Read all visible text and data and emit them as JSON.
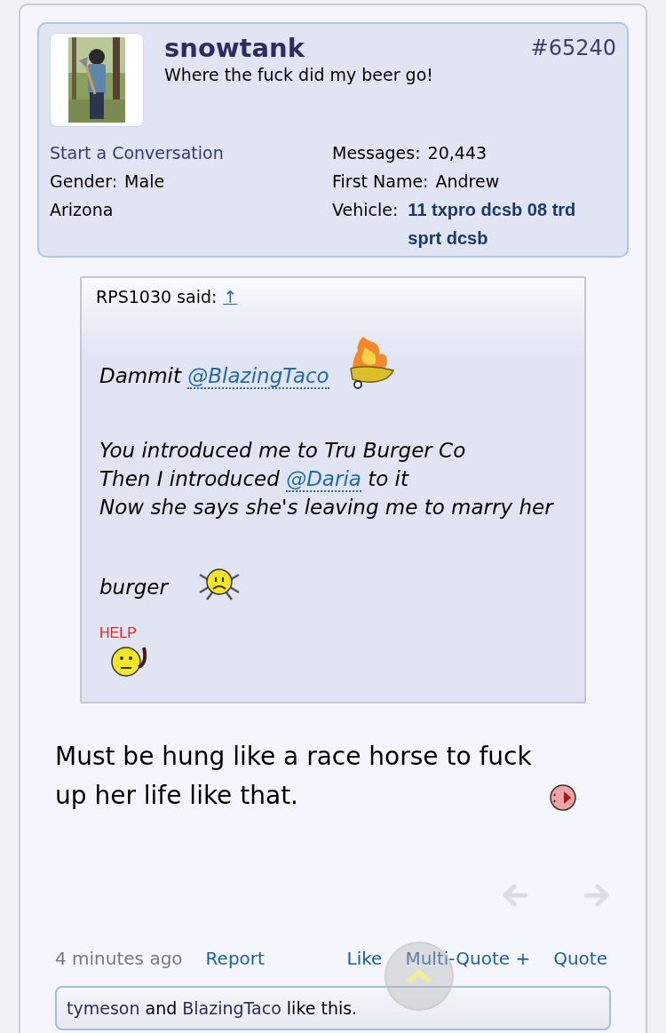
{
  "post": {
    "number": "#65240",
    "user": {
      "name": "snowtank",
      "title": "Where the fuck did my beer go!"
    },
    "left_info": [
      {
        "kind": "link",
        "text": "Start a Conversation"
      },
      {
        "kind": "field",
        "label": "Gender:",
        "value": "Male"
      },
      {
        "kind": "plain",
        "text": "Arizona"
      }
    ],
    "right_info": [
      {
        "kind": "field",
        "label": "Messages:",
        "value": "20,443"
      },
      {
        "kind": "field",
        "label": "First Name:",
        "value": "Andrew"
      },
      {
        "kind": "bold_field",
        "label": "Vehicle:",
        "value": "11 txpro dcsb 08 trd sprt dcsb"
      }
    ],
    "quote": {
      "author": "RPS1030 said:",
      "jump_link": "↑",
      "paragraphs": [
        [
          [
            {
              "kind": "text",
              "text": "Dammit "
            },
            {
              "kind": "mention",
              "text": "@BlazingTaco"
            },
            {
              "kind": "fire_smiley"
            }
          ]
        ],
        [
          [
            {
              "kind": "text",
              "text": "You introduced me to Tru Burger Co"
            }
          ],
          [
            {
              "kind": "text",
              "text": "Then I introduced "
            },
            {
              "kind": "mention",
              "text": "@Daria"
            },
            {
              "kind": "text",
              "text": " to it"
            }
          ],
          [
            {
              "kind": "text",
              "text": "Now she says she's leaving me to marry her"
            }
          ]
        ],
        [
          [
            {
              "kind": "text",
              "text": "burger"
            },
            {
              "kind": "spider_smiley"
            }
          ]
        ],
        [
          [
            {
              "kind": "help_smiley",
              "text": "HELP"
            }
          ]
        ]
      ]
    },
    "message": [
      {
        "kind": "text",
        "text": "Must be hung like a race horse to fuck up her life like that."
      },
      {
        "kind": "pig_smiley"
      }
    ],
    "footer": {
      "time": "4 minutes ago",
      "report": "Report",
      "actions": [
        "Like",
        "Multi-Quote +",
        "Quote"
      ]
    },
    "likes": [
      {
        "kind": "user",
        "text": "tymeson"
      },
      {
        "kind": "text",
        "text": " and "
      },
      {
        "kind": "user",
        "text": "BlazingTaco"
      },
      {
        "kind": "text",
        "text": " like this."
      }
    ]
  }
}
